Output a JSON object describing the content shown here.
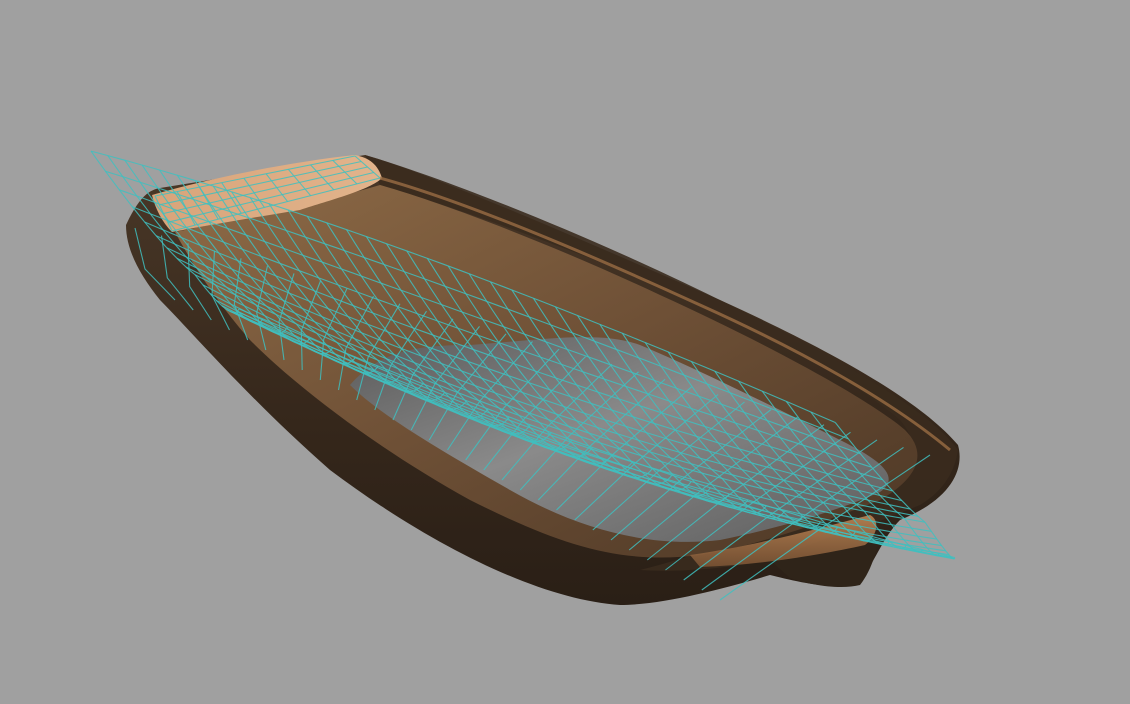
{
  "viewport": {
    "background_color": "#a0a0a0",
    "render_mode": "smooth-shaded-with-wireframe"
  },
  "model": {
    "object": "boat-hull",
    "colors": {
      "hull_outer": "#3e2f22",
      "hull_outer_dark": "#2b2118",
      "deck_top": "#d9a57a",
      "deck_edge": "#b57a48",
      "interior_wall": "#7a5a3c",
      "interior_floor": "#6b6b6b",
      "interior_floor_light": "#8a8a8a",
      "wireframe": "#3fbfbf"
    }
  }
}
